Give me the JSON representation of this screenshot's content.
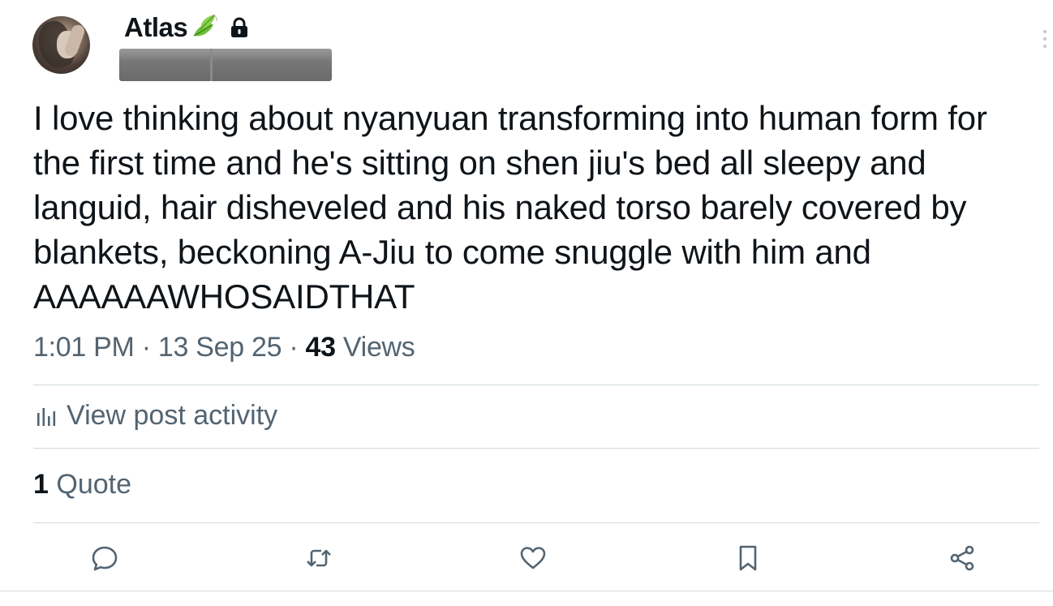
{
  "post": {
    "author_name": "Atlas",
    "author_emoji_icon": "leaf-icon",
    "lock_icon": "lock-icon",
    "text": "I love thinking about nyanyuan transforming into human form for the first time and he's sitting on shen jiu's bed all sleepy and languid, hair disheveled and his naked torso barely covered by blankets, beckoning A-Jiu to come snuggle with him and AAAAAAWHOSAIDTHAT",
    "time": "1:01 PM",
    "date": "13 Sep 25",
    "separator": "·",
    "views_count": "43",
    "views_label": "Views"
  },
  "activity": {
    "label": "View post activity",
    "icon": "bar-chart-icon"
  },
  "quotes": {
    "count": "1",
    "label": "Quote"
  },
  "actions": [
    "reply-icon",
    "retweet-icon",
    "like-icon",
    "bookmark-icon",
    "share-icon"
  ],
  "colors": {
    "text": "#0f1419",
    "secondary": "#536471",
    "divider": "#cfd9de",
    "leaf": "#6fbf3a"
  }
}
